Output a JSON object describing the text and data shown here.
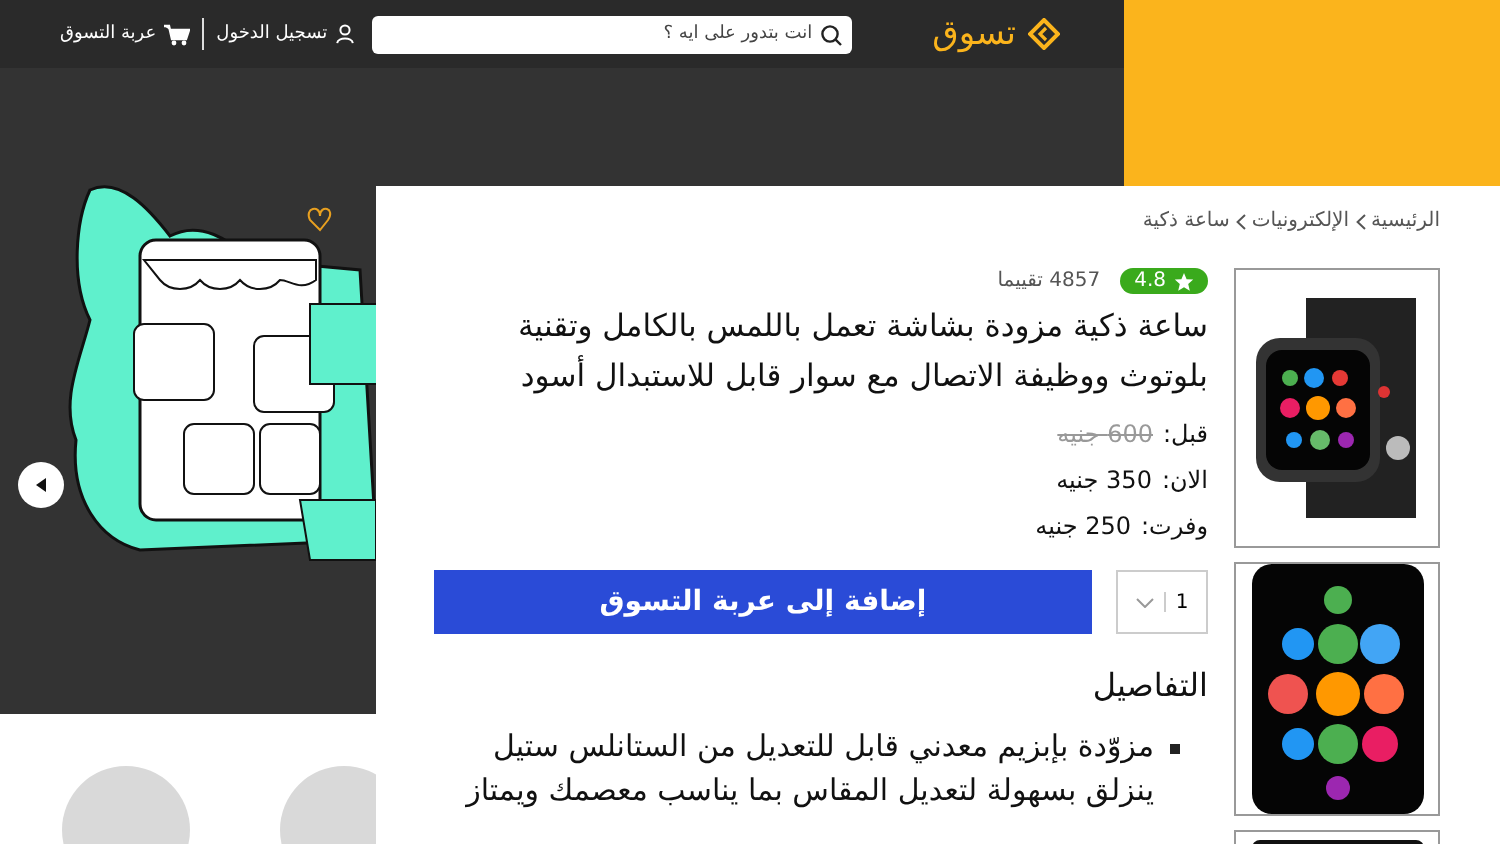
{
  "header": {
    "logo": "تسوق",
    "search": {
      "placeholder": "انت بتدور على ايه ؟"
    },
    "login": "تسجيل الدخول",
    "cart": "عربة التسوق"
  },
  "product": {
    "breadcrumb": [
      "الرئيسية",
      "الإلكترونيات",
      "ساعة ذكية"
    ],
    "rating": "4.8",
    "reviews": "4857 تقييما",
    "title": "ساعة ذكية مزودة بشاشة تعمل باللمس بالكامل وتقنية بلوتوث ووظيفة الاتصال مع سوار قابل للاستبدال أسود",
    "prices": [
      {
        "kind": "old",
        "label": "قبل:",
        "value": "600 جنيه"
      },
      {
        "kind": "current",
        "label": "الان:",
        "value": "350 جنيه"
      },
      {
        "kind": "saved",
        "label": "وفرت:",
        "value": "250 جنيه"
      }
    ],
    "quantity": "1",
    "add_to_cart": "إضافة إلى عربة التسوق",
    "details_heading": "التفاصيل",
    "details": [
      "مزوّدة بإبزيم معدني قابل للتعديل من الستانلس ستيل ينزلق بسهولة لتعديل المقاس بما يناسب معصمك ويمتاز"
    ]
  }
}
